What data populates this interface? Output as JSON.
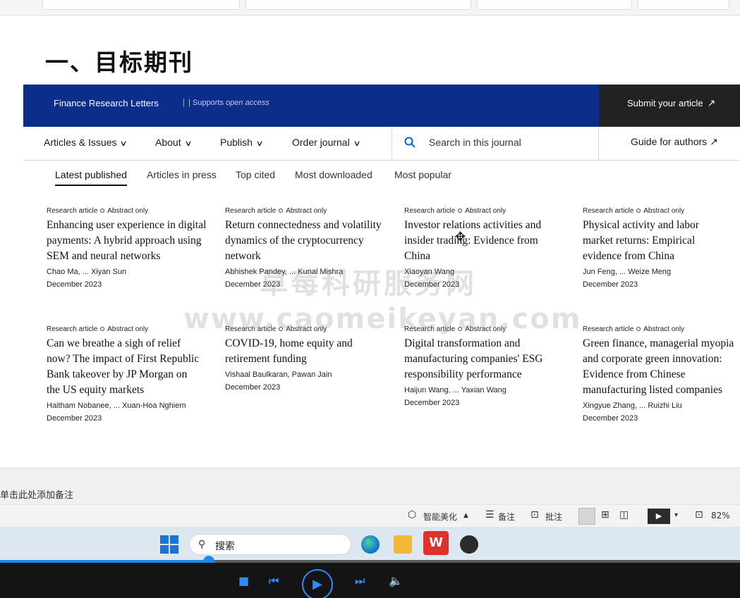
{
  "slide": {
    "title": "一、目标期刊"
  },
  "journal": {
    "name": "Finance Research Letters",
    "support_prefix": "| Supports ",
    "support_italic": "open access",
    "submit": "Submit your article",
    "submit_arrow": "↗"
  },
  "nav": {
    "items": [
      "Articles & Issues",
      "About",
      "Publish",
      "Order journal"
    ],
    "chevron": "∨",
    "search_placeholder": "Search in this journal",
    "guide": "Guide for authors",
    "guide_arrow": "↗"
  },
  "tabs": [
    "Latest published",
    "Articles in press",
    "Top cited",
    "Most downloaded",
    "Most popular"
  ],
  "articles": [
    {
      "type": "Research article",
      "access": "Abstract only",
      "title": "Enhancing user experience in digital payments: A hybrid approach using SEM and neural networks",
      "authors": "Chao Ma, ... Xiyan Sun",
      "date": "December 2023"
    },
    {
      "type": "Research article",
      "access": "Abstract only",
      "title": "Return connectedness and volatility dynamics of the cryptocurrency network",
      "authors": "Abhishek Pandey, ... Kunal Mishra",
      "date": "December 2023"
    },
    {
      "type": "Research article",
      "access": "Abstract only",
      "title": "Investor relations activities and insider trading: Evidence from China",
      "authors": "Xiaoyan Wang",
      "date": "December 2023"
    },
    {
      "type": "Research article",
      "access": "Abstract only",
      "title": "Physical activity and labor market returns: Empirical evidence from China",
      "authors": "Jun Feng, ... Weize Meng",
      "date": "December 2023"
    },
    {
      "type": "Research article",
      "access": "Abstract only",
      "title": "Can we breathe a sigh of relief now? The impact of First Republic Bank takeover by JP Morgan on the US equity markets",
      "authors": "Haitham Nobanee, ... Xuan-Hoa Nghiem",
      "date": "December 2023"
    },
    {
      "type": "Research article",
      "access": "Abstract only",
      "title": "COVID-19, home equity and retirement funding",
      "authors": "Vishaal Baulkaran, Pawan Jain",
      "date": "December 2023"
    },
    {
      "type": "Research article",
      "access": "Abstract only",
      "title": "Digital transformation and manufacturing companies' ESG responsibility performance",
      "authors": "Haijun Wang, ... Yaxian Wang",
      "date": "December 2023"
    },
    {
      "type": "Research article",
      "access": "Abstract only",
      "title": "Green finance, managerial myopia and corporate green innovation: Evidence from Chinese manufacturing listed companies",
      "authors": "Xingyue Zhang, ... Ruizhi Liu",
      "date": "December 2023"
    }
  ],
  "watermark": {
    "cn": "草莓科研服务网",
    "url": "www.caomeikeyan.com"
  },
  "notes": {
    "placeholder": "单击此处添加备注"
  },
  "statusbar": {
    "beautify": "智能美化",
    "notes": "备注",
    "comments": "批注",
    "zoom": "82%"
  },
  "taskbar": {
    "search": "搜索",
    "wps": "W"
  },
  "player": {
    "progress": 0.28
  },
  "colors": {
    "journal_bar": "#0c2d8a",
    "submit_bg": "#222222",
    "player_accent": "#2f8cff"
  }
}
